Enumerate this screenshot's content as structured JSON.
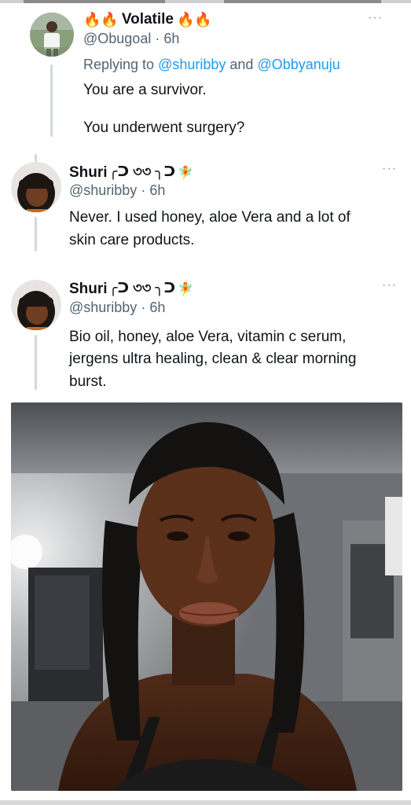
{
  "tweet1": {
    "emoji_left": "🔥🔥",
    "name": "Volatile",
    "emoji_right": "🔥🔥",
    "handle": "@Obugoal",
    "time": "· 6h",
    "replying_prefix": "Replying to",
    "mention1": "@shuribby",
    "and_word": "and",
    "mention2": "@Obbyanuju",
    "line1": "You are a survivor.",
    "line2": "You underwent surgery?",
    "more": "···"
  },
  "tweet2": {
    "name": "Shuri",
    "kaomoji": "╭ᑐ ৩৩ ╮ᑐ",
    "fairy": "🧚",
    "handle": "@shuribby",
    "time": "· 6h",
    "line1": "Never. I used honey, aloe Vera and a lot of",
    "line2": "skin care products.",
    "more": "···"
  },
  "tweet3": {
    "name": "Shuri",
    "kaomoji": "╭ᑐ ৩৩ ╮ᑐ",
    "fairy": "🧚",
    "handle": "@shuribby",
    "time": "· 6h",
    "line1": "Bio oil, honey, aloe Vera, vitamin c serum,",
    "line2": "jergens ultra healing, clean & clear morning",
    "line3": "burst.",
    "more": "···"
  }
}
